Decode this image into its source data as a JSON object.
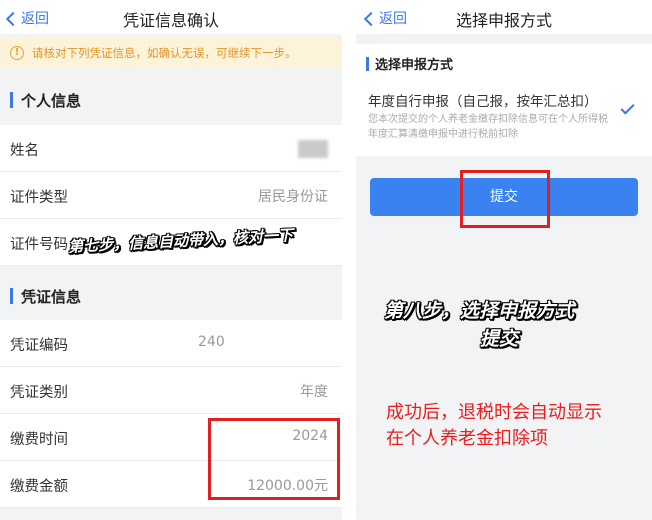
{
  "left": {
    "nav": {
      "back_label": "返回",
      "title": "凭证信息确认"
    },
    "notice": "请核对下列凭证信息，如确认无误，可继续下一步。",
    "personal": {
      "header": "个人信息",
      "rows": [
        {
          "label": "姓名",
          "value": ""
        },
        {
          "label": "证件类型",
          "value": "居民身份证"
        },
        {
          "label": "证件号码",
          "value": ""
        }
      ]
    },
    "voucher": {
      "header": "凭证信息",
      "rows": [
        {
          "label": "凭证编码",
          "value": "240"
        },
        {
          "label": "凭证类别",
          "value": "年度"
        },
        {
          "label": "缴费时间",
          "value": "2024"
        },
        {
          "label": "缴费金额",
          "value": "12000.00元"
        }
      ]
    },
    "step_caption": "第七步，信息自动带入，核对一下"
  },
  "right": {
    "nav": {
      "back_label": "返回",
      "title": "选择申报方式"
    },
    "section_title": "选择申报方式",
    "option_label": "年度自行申报（自己报，按年汇总扣）",
    "option_desc": "您本次提交的个人养老金缴存扣除信息可在个人所得税年度汇算清缴申报中进行税前扣除",
    "submit_label": "提交",
    "step_caption_line1": "第八步，选择申报方式",
    "step_caption_line2": "提交",
    "note_line1": "成功后，退税时会自动显示",
    "note_line2": "在个人养老金扣除项"
  },
  "colors": {
    "accent": "#3b79e6",
    "annotation_red": "#e02020",
    "notice_bg": "#fdf3d8",
    "notice_text": "#e0952e"
  }
}
